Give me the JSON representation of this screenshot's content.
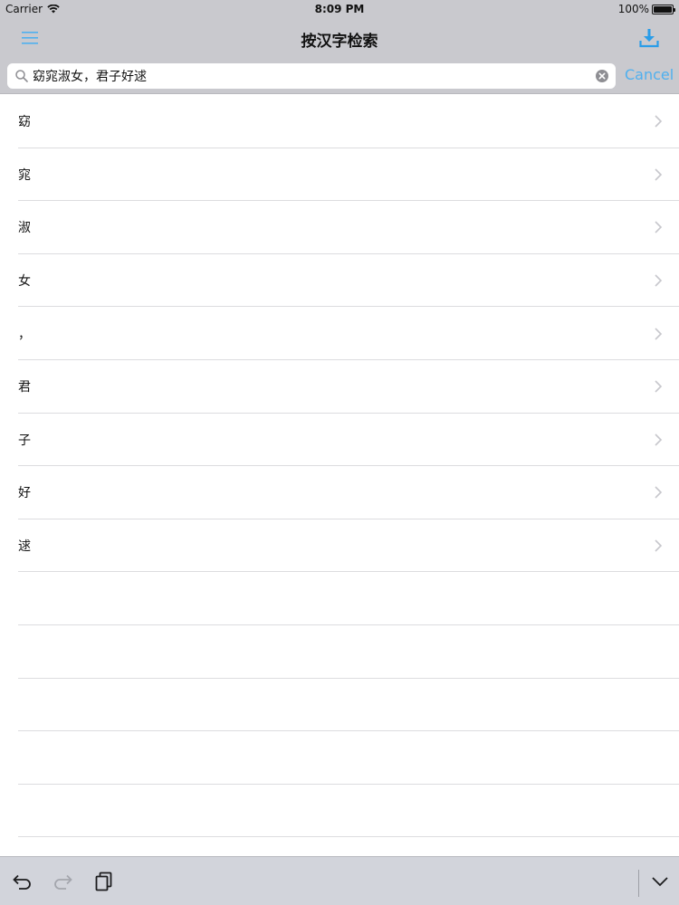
{
  "status_bar": {
    "carrier": "Carrier",
    "time": "8:09 PM",
    "battery": "100%",
    "battery_level": 1.0
  },
  "nav": {
    "title": "按汉字检索",
    "menu_icon": "hamburger-menu-icon",
    "download_icon": "download-icon"
  },
  "search": {
    "value": "窈窕淑女，君子好逑",
    "cancel_label": "Cancel"
  },
  "results": [
    {
      "label": "窈"
    },
    {
      "label": "窕"
    },
    {
      "label": "淑"
    },
    {
      "label": "女"
    },
    {
      "label": "，"
    },
    {
      "label": "君"
    },
    {
      "label": "子"
    },
    {
      "label": "好"
    },
    {
      "label": "逑"
    }
  ],
  "colors": {
    "accent": "#4fb0ef",
    "bar_background": "#c9c9ce",
    "keyboard_bar_background": "#d2d4db"
  }
}
